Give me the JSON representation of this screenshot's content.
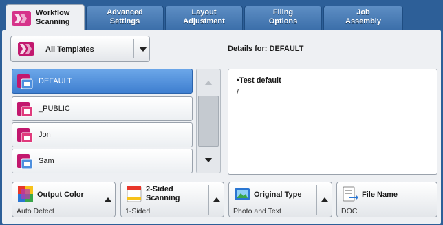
{
  "tabs": [
    {
      "line1": "Workflow",
      "line2": "Scanning",
      "active": true,
      "icon": "workflow-scan-icon"
    },
    {
      "line1": "Advanced",
      "line2": "Settings",
      "active": false
    },
    {
      "line1": "Layout",
      "line2": "Adjustment",
      "active": false
    },
    {
      "line1": "Filing",
      "line2": "Options",
      "active": false
    },
    {
      "line1": "Job",
      "line2": "Assembly",
      "active": false
    }
  ],
  "template_filter": {
    "label": "All Templates",
    "icon": "all-templates-icon"
  },
  "details": {
    "header": "Details for: DEFAULT",
    "lines": [
      "•Test default",
      "/"
    ]
  },
  "templates": [
    {
      "name": "DEFAULT",
      "selected": true,
      "icon": "template-icon"
    },
    {
      "name": "_PUBLIC",
      "selected": false,
      "icon": "template-icon"
    },
    {
      "name": "Jon",
      "selected": false,
      "icon": "template-icon"
    },
    {
      "name": "Sam",
      "selected": false,
      "icon": "template-icon"
    }
  ],
  "feature_buttons": [
    {
      "title": "Output Color",
      "value": "Auto Detect",
      "icon": "output-color-icon"
    },
    {
      "title_line1": "2-Sided",
      "title_line2": "Scanning",
      "value": "1-Sided",
      "icon": "two-sided-icon"
    },
    {
      "title": "Original Type",
      "value": "Photo and Text",
      "icon": "original-type-icon"
    },
    {
      "title": "File Name",
      "value": "DOC",
      "icon": "file-name-icon"
    }
  ],
  "colors": {
    "background": "#2d5f98",
    "panel": "#eef0f3",
    "selection": "#4d8fde",
    "accent_pink": "#c2186e"
  }
}
